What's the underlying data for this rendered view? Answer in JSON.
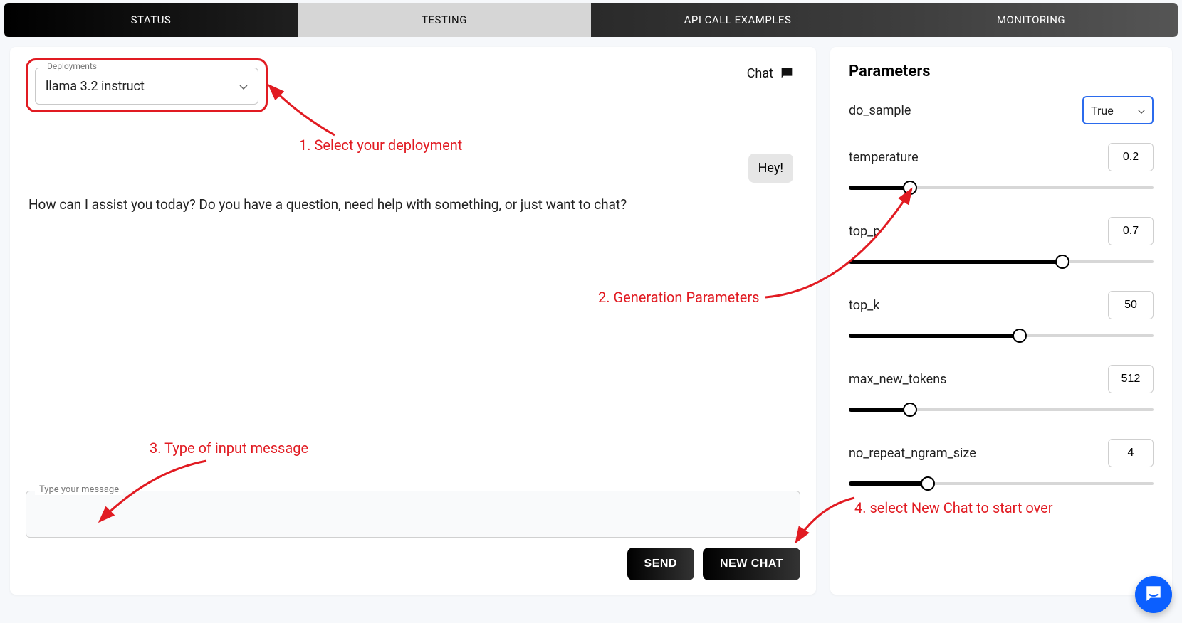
{
  "tabs": {
    "status": "STATUS",
    "testing": "TESTING",
    "api": "API CALL EXAMPLES",
    "monitoring": "MONITORING"
  },
  "deployments": {
    "legend": "Deployments",
    "selected": "llama 3.2 instruct"
  },
  "chat": {
    "header_label": "Chat",
    "user_bubble": "Hey!",
    "assistant_message": "How can I assist you today? Do you have a question, need help with something, or just want to chat?",
    "input_legend": "Type your message",
    "input_value": "",
    "send_label": "SEND",
    "new_chat_label": "NEW CHAT"
  },
  "parameters": {
    "title": "Parameters",
    "do_sample": {
      "label": "do_sample",
      "value": "True"
    },
    "temperature": {
      "label": "temperature",
      "value": "0.2",
      "pct": 20
    },
    "top_p": {
      "label": "top_p",
      "value": "0.7",
      "pct": 70
    },
    "top_k": {
      "label": "top_k",
      "value": "50",
      "pct": 56
    },
    "max_new_tokens": {
      "label": "max_new_tokens",
      "value": "512",
      "pct": 20
    },
    "no_repeat_ngram_size": {
      "label": "no_repeat_ngram_size",
      "value": "4",
      "pct": 26
    }
  },
  "annotations": {
    "a1": "1. Select your deployment",
    "a2": "2. Generation Parameters",
    "a3": "3. Type of input message",
    "a4": "4. select New Chat to start over"
  }
}
